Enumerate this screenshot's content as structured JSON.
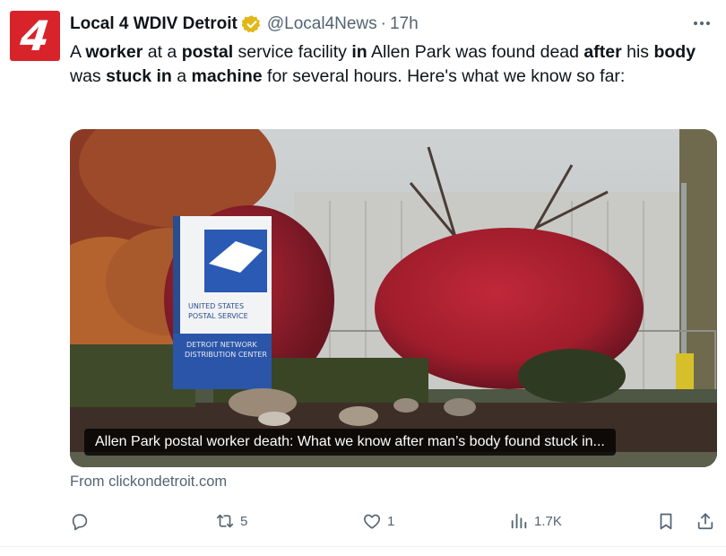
{
  "author": {
    "display_name": "Local 4 WDIV Detroit",
    "handle": "@Local4News",
    "separator": "·",
    "time": "17h",
    "avatar_text": "4",
    "verified": "gold-check"
  },
  "tweet": {
    "segments": [
      {
        "text": "A ",
        "bold": false
      },
      {
        "text": "worker",
        "bold": true
      },
      {
        "text": " at a ",
        "bold": false
      },
      {
        "text": "postal",
        "bold": true
      },
      {
        "text": " service facility ",
        "bold": false
      },
      {
        "text": "in",
        "bold": true
      },
      {
        "text": " Allen Park was found dead ",
        "bold": false
      },
      {
        "text": "after",
        "bold": true
      },
      {
        "text": " his ",
        "bold": false
      },
      {
        "text": "body",
        "bold": true
      },
      {
        "text": " was ",
        "bold": false
      },
      {
        "text": "stuck in",
        "bold": true
      },
      {
        "text": " a ",
        "bold": false
      },
      {
        "text": "machine",
        "bold": true
      },
      {
        "text": " for several hours. Here's what we know so far:",
        "bold": false
      }
    ]
  },
  "card": {
    "caption": "Allen Park postal worker death: What we know after man’s body found stuck in...",
    "sign_lines": [
      "UNITED STATES",
      "POSTAL SERVICE",
      "DETROIT NETWORK",
      "DISTRIBUTION CENTER"
    ],
    "source": "From clickondetroit.com"
  },
  "actions": {
    "reply": {
      "icon": "reply-icon",
      "count": ""
    },
    "retweet": {
      "icon": "retweet-icon",
      "count": "5"
    },
    "like": {
      "icon": "heart-icon",
      "count": "1"
    },
    "views": {
      "icon": "views-chart-icon",
      "count": "1.7K"
    },
    "bookmark": {
      "icon": "bookmark-icon"
    },
    "share": {
      "icon": "share-icon"
    }
  },
  "colors": {
    "brand_red": "#d8232a",
    "verified_gold": "#e2b719",
    "text_primary": "#0f1419",
    "text_secondary": "#536471"
  }
}
